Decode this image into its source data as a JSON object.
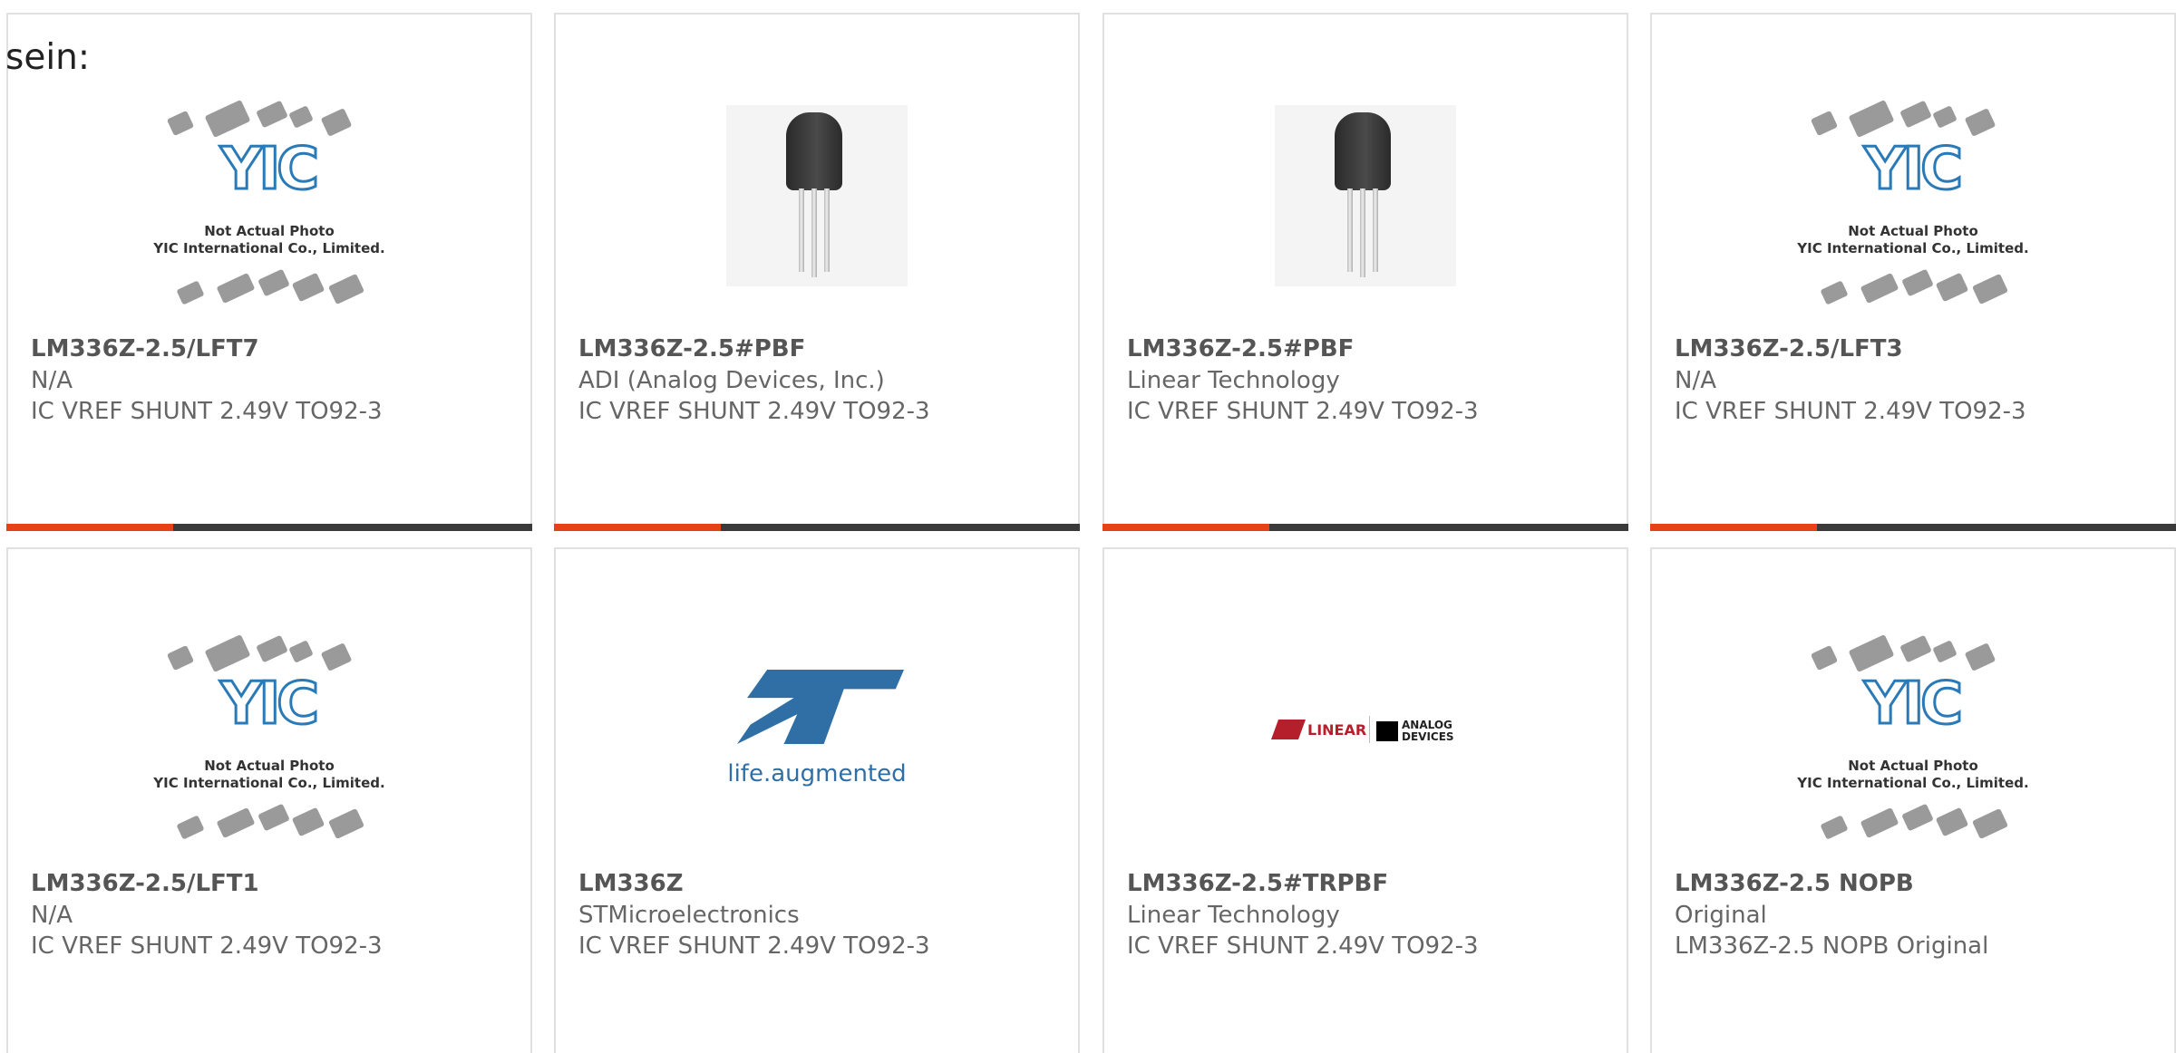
{
  "lead_text": "sein:",
  "placeholder": {
    "line1": "Not Actual Photo",
    "line2": "YIC International Co., Limited.",
    "logo": "YIC"
  },
  "logos": {
    "st_tagline": "life.augmented",
    "lt_word": "LINEAR",
    "adi_word": "ANALOG DEVICES"
  },
  "colors": {
    "accent": "#e84118",
    "bar": "#3a3a3a",
    "yic_blue": "#2a7ab8",
    "st_blue": "#2f6fa5"
  },
  "products": [
    {
      "part": "LM336Z-2.5/LFT7",
      "manufacturer": "N/A",
      "description": "IC VREF SHUNT 2.49V TO92-3",
      "image": "yic-placeholder"
    },
    {
      "part": "LM336Z-2.5#PBF",
      "manufacturer": "ADI (Analog Devices, Inc.)",
      "description": "IC VREF SHUNT 2.49V TO92-3",
      "image": "to92-transistor"
    },
    {
      "part": "LM336Z-2.5#PBF",
      "manufacturer": "Linear Technology",
      "description": "IC VREF SHUNT 2.49V TO92-3",
      "image": "to92-transistor"
    },
    {
      "part": "LM336Z-2.5/LFT3",
      "manufacturer": "N/A",
      "description": "IC VREF SHUNT 2.49V TO92-3",
      "image": "yic-placeholder"
    },
    {
      "part": "LM336Z-2.5/LFT1",
      "manufacturer": "N/A",
      "description": "IC VREF SHUNT 2.49V TO92-3",
      "image": "yic-placeholder"
    },
    {
      "part": "LM336Z",
      "manufacturer": "STMicroelectronics",
      "description": "IC VREF SHUNT 2.49V TO92-3",
      "image": "st-logo"
    },
    {
      "part": "LM336Z-2.5#TRPBF",
      "manufacturer": "Linear Technology",
      "description": "IC VREF SHUNT 2.49V TO92-3",
      "image": "lt-adi-logo"
    },
    {
      "part": "LM336Z-2.5 NOPB",
      "manufacturer": "Original",
      "description": "LM336Z-2.5 NOPB Original",
      "image": "yic-placeholder"
    }
  ]
}
